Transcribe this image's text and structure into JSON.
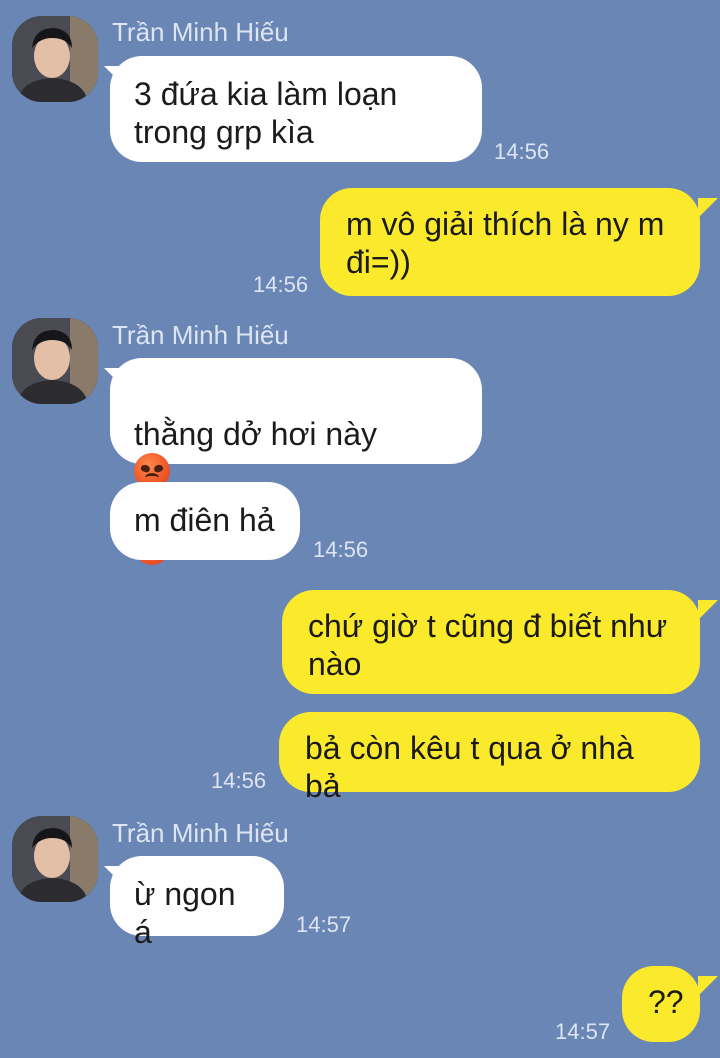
{
  "contact": {
    "name": "Trần Minh Hiếu"
  },
  "messages": [
    {
      "text": "3 đứa kia làm loạn\ntrong grp kìa",
      "time": "14:56"
    },
    {
      "text": "m vô giải thích là ny m\nđi=))",
      "time": "14:56"
    },
    {
      "text_line1": "thằng dở hơi này",
      "emoji": "angry-face-emoji"
    },
    {
      "text": "m điên hả",
      "time": "14:56"
    },
    {
      "text": "chứ giờ t cũng đ biết như\nnào"
    },
    {
      "text": "bả còn kêu t qua ở nhà bả",
      "time": "14:56"
    },
    {
      "text": "ừ ngon á",
      "time": "14:57"
    },
    {
      "text": "??",
      "time": "14:57"
    }
  ],
  "colors": {
    "background": "#6a86b5",
    "incoming_bubble": "#ffffff",
    "outgoing_bubble": "#fbe92b"
  }
}
